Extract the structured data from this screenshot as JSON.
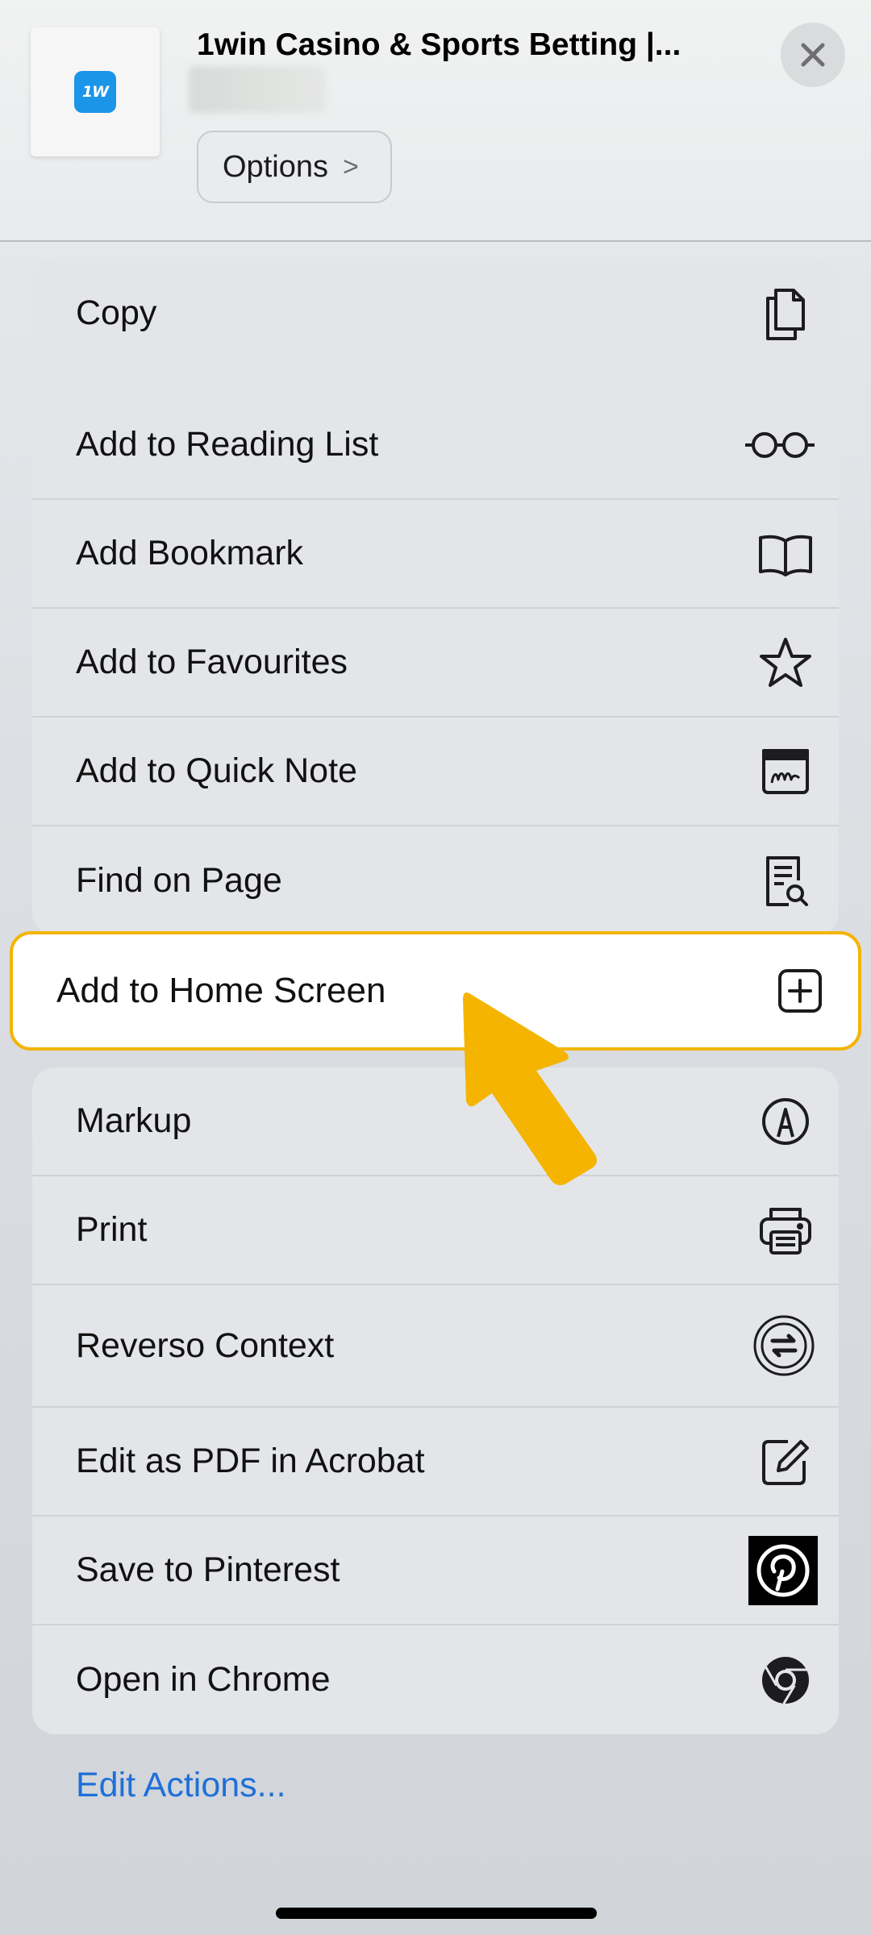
{
  "header": {
    "app_logo_text": "1W",
    "page_title": "1win Casino & Sports Betting |...",
    "options_label": "Options",
    "options_chevron": ">"
  },
  "groups": {
    "copy": {
      "label": "Copy",
      "icon": "copy-icon"
    },
    "actions": [
      {
        "label": "Add to Reading List",
        "icon": "glasses-icon"
      },
      {
        "label": "Add Bookmark",
        "icon": "book-icon"
      },
      {
        "label": "Add to Favourites",
        "icon": "star-icon"
      },
      {
        "label": "Add to Quick Note",
        "icon": "quick-note-icon"
      },
      {
        "label": "Find on Page",
        "icon": "find-on-page-icon"
      }
    ],
    "highlighted": {
      "label": "Add to Home Screen",
      "icon": "plus-square-icon",
      "highlight_color": "#f4b400"
    },
    "extensions": [
      {
        "label": "Markup",
        "icon": "markup-pen-icon"
      },
      {
        "label": "Print",
        "icon": "printer-icon"
      },
      {
        "label": "Reverso Context",
        "icon": "reverso-icon"
      },
      {
        "label": "Edit as PDF in Acrobat",
        "icon": "edit-icon"
      },
      {
        "label": "Save to Pinterest",
        "icon": "pinterest-icon"
      },
      {
        "label": "Open in Chrome",
        "icon": "chrome-icon"
      }
    ]
  },
  "footer": {
    "edit_actions_label": "Edit Actions...",
    "link_color": "#1f6fd8"
  },
  "colors": {
    "arrow": "#f4b400",
    "logo_blue": "#1a95e8"
  }
}
